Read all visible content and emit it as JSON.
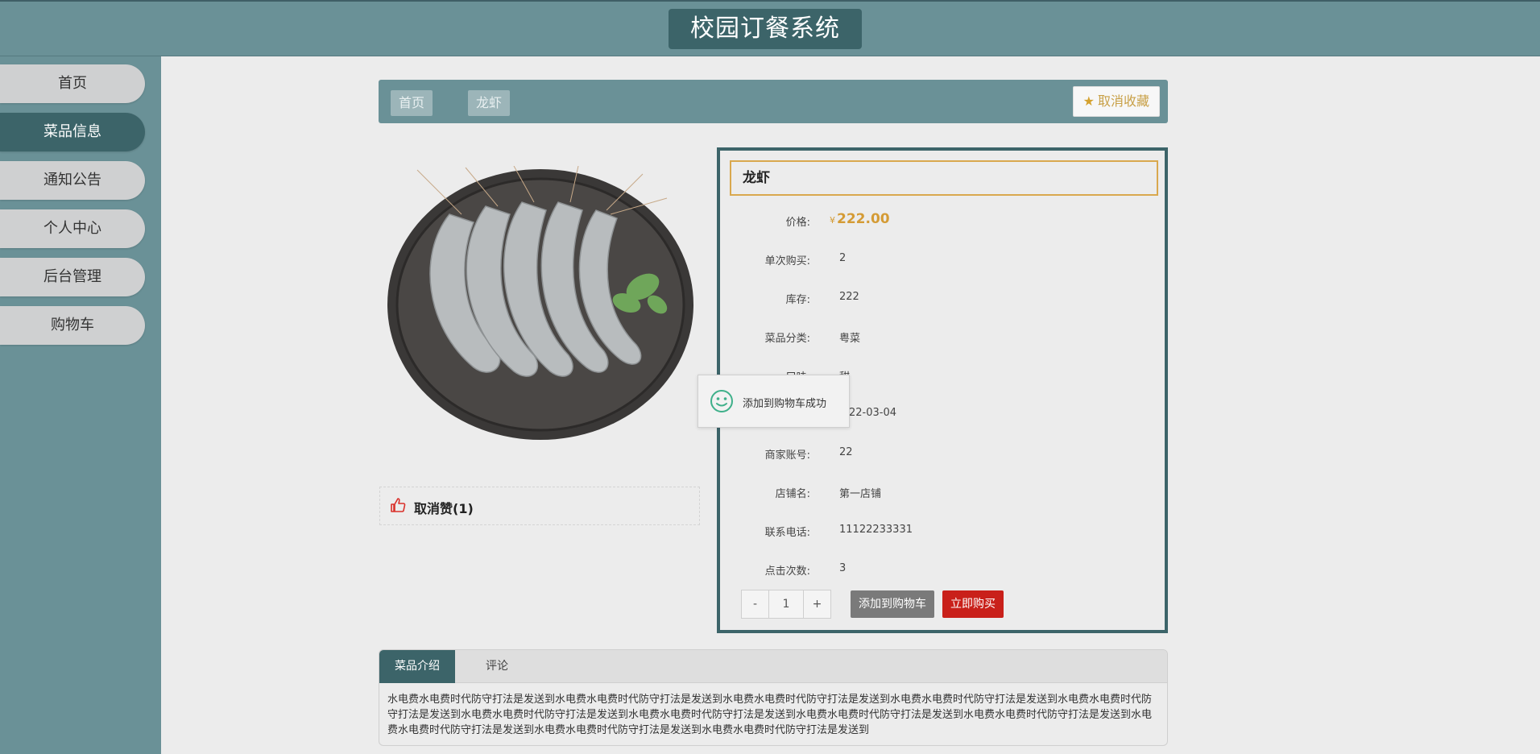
{
  "app": {
    "title": "校园订餐系统"
  },
  "sidebar": {
    "items": [
      {
        "label": "首页"
      },
      {
        "label": "菜品信息"
      },
      {
        "label": "通知公告"
      },
      {
        "label": "个人中心"
      },
      {
        "label": "后台管理"
      },
      {
        "label": "购物车"
      }
    ]
  },
  "breadcrumb": {
    "home": "首页",
    "current": "龙虾"
  },
  "favorite": {
    "label": "取消收藏"
  },
  "like": {
    "label": "取消赞(1)"
  },
  "product": {
    "name": "龙虾",
    "price_symbol": "¥",
    "price": "222.00",
    "fields": [
      {
        "label": "价格:"
      },
      {
        "label": "单次购买:",
        "value": "2"
      },
      {
        "label": "库存:",
        "value": "222"
      },
      {
        "label": "菜品分类:",
        "value": "粤菜"
      },
      {
        "label": "口味:",
        "value": "甜"
      },
      {
        "label": "",
        "value": "22-03-04"
      },
      {
        "label": "商家账号:",
        "value": "22"
      },
      {
        "label": "店铺名:",
        "value": "第一店铺"
      },
      {
        "label": "联系电话:",
        "value": "11122233331"
      },
      {
        "label": "点击次数:",
        "value": "3"
      }
    ]
  },
  "quantity": {
    "minus": "-",
    "value": "1",
    "plus": "+"
  },
  "actions": {
    "add_to_cart": "添加到购物车",
    "buy_now": "立即购买"
  },
  "toast": {
    "message": "添加到购物车成功"
  },
  "tabs": {
    "items": [
      {
        "label": "菜品介绍"
      },
      {
        "label": "评论"
      }
    ],
    "intro": "水电费水电费时代防守打法是发送到水电费水电费时代防守打法是发送到水电费水电费时代防守打法是发送到水电费水电费时代防守打法是发送到水电费水电费时代防守打法是发送到水电费水电费时代防守打法是发送到水电费水电费时代防守打法是发送到水电费水电费时代防守打法是发送到水电费水电费时代防守打法是发送到水电费水电费时代防守打法是发送到水电费水电费时代防守打法是发送到水电费水电费时代防守打法是发送到"
  },
  "colors": {
    "teal": "#6a9197",
    "teal_dark": "#3c6469",
    "price": "#d49b35",
    "buy": "#c9201a",
    "accent_border": "#d9a84e"
  }
}
